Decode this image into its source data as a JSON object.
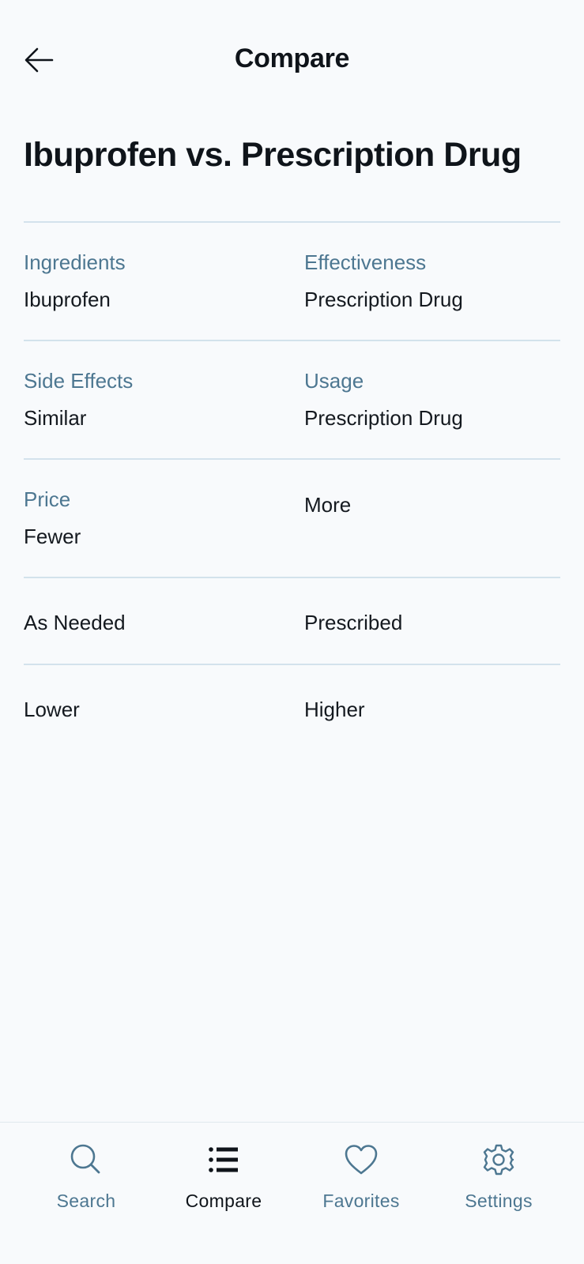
{
  "header": {
    "title": "Compare",
    "back_icon": "arrow-left-icon"
  },
  "page_title": "Ibuprofen vs. Prescription Drug",
  "rows": [
    {
      "left_label": "Ingredients",
      "left_value": "Ibuprofen",
      "right_label": "Effectiveness",
      "right_value": "Prescription Drug"
    },
    {
      "left_label": "Side Effects",
      "left_value": "Similar",
      "right_label": "Usage",
      "right_value": "Prescription Drug"
    },
    {
      "left_label": "Price",
      "left_value": "Fewer",
      "right_value": "More"
    },
    {
      "left_value": "As Needed",
      "right_value": "Prescribed"
    },
    {
      "left_value": "Lower",
      "right_value": "Higher"
    }
  ],
  "nav": {
    "items": [
      {
        "label": "Search",
        "icon": "search-icon",
        "active": false
      },
      {
        "label": "Compare",
        "icon": "list-icon",
        "active": true
      },
      {
        "label": "Favorites",
        "icon": "heart-icon",
        "active": false
      },
      {
        "label": "Settings",
        "icon": "gear-icon",
        "active": false
      }
    ]
  },
  "colors": {
    "background": "#f8fafc",
    "label": "#4d7791",
    "text": "#0f141a",
    "divider": "#d3e2ec"
  }
}
